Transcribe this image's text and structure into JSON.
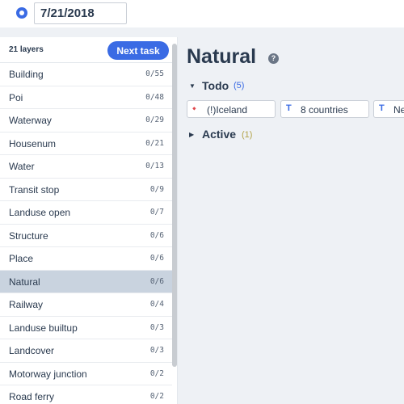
{
  "header": {
    "date_value": "7/21/2018"
  },
  "sidebar": {
    "layer_count": "21 layers",
    "next_task_label": "Next task",
    "layers": [
      {
        "name": "Building",
        "progress": "0/55"
      },
      {
        "name": "Poi",
        "progress": "0/48"
      },
      {
        "name": "Waterway",
        "progress": "0/29"
      },
      {
        "name": "Housenum",
        "progress": "0/21"
      },
      {
        "name": "Water",
        "progress": "0/13"
      },
      {
        "name": "Transit stop",
        "progress": "0/9"
      },
      {
        "name": "Landuse open",
        "progress": "0/7"
      },
      {
        "name": "Structure",
        "progress": "0/6"
      },
      {
        "name": "Place",
        "progress": "0/6"
      },
      {
        "name": "Natural",
        "progress": "0/6",
        "selected": true
      },
      {
        "name": "Railway",
        "progress": "0/4"
      },
      {
        "name": "Landuse builtup",
        "progress": "0/3"
      },
      {
        "name": "Landcover",
        "progress": "0/3"
      },
      {
        "name": "Motorway junction",
        "progress": "0/2"
      },
      {
        "name": "Road ferry",
        "progress": "0/2"
      }
    ]
  },
  "main": {
    "title": "Natural",
    "help_icon": "?",
    "todo": {
      "label": "Todo",
      "count": "(5)"
    },
    "active": {
      "label": "Active",
      "count": "(1)"
    },
    "chips": [
      {
        "icon": "diamond-icon",
        "glyph": "⬩",
        "label": "(!)Iceland"
      },
      {
        "icon": "text-type-icon",
        "glyph": "T",
        "label": "8 countries"
      },
      {
        "icon": "text-type-icon",
        "glyph": "T",
        "label": "Ne"
      }
    ]
  },
  "colors": {
    "accent": "#3a6be4",
    "selected_row": "#c9d3df",
    "active_count": "#b3a34a",
    "diamond_icon": "#e0474c"
  }
}
